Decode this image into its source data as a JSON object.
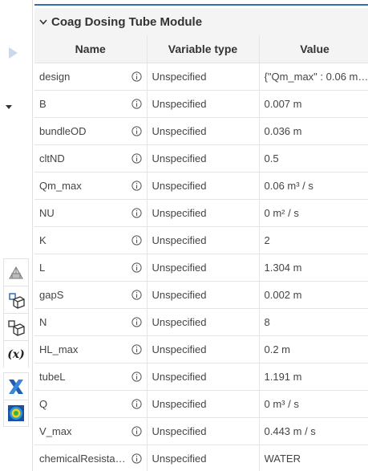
{
  "module": {
    "title": "Coag Dosing Tube Module"
  },
  "table": {
    "headers": {
      "name": "Name",
      "type": "Variable type",
      "value": "Value"
    },
    "rows": [
      {
        "name": "design",
        "type": "Unspecified",
        "value": "{\"Qm_max\" : 0.06 m…"
      },
      {
        "name": "B",
        "type": "Unspecified",
        "value": "0.007 m"
      },
      {
        "name": "bundleOD",
        "type": "Unspecified",
        "value": "0.036 m"
      },
      {
        "name": "cltND",
        "type": "Unspecified",
        "value": "0.5"
      },
      {
        "name": "Qm_max",
        "type": "Unspecified",
        "value": "0.06 m³ / s"
      },
      {
        "name": "NU",
        "type": "Unspecified",
        "value": "0 m² / s"
      },
      {
        "name": "K",
        "type": "Unspecified",
        "value": "2"
      },
      {
        "name": "L",
        "type": "Unspecified",
        "value": "1.304 m"
      },
      {
        "name": "gapS",
        "type": "Unspecified",
        "value": "0.002 m"
      },
      {
        "name": "N",
        "type": "Unspecified",
        "value": "8"
      },
      {
        "name": "HL_max",
        "type": "Unspecified",
        "value": "0.2 m"
      },
      {
        "name": "tubeL",
        "type": "Unspecified",
        "value": "1.191 m"
      },
      {
        "name": "Q",
        "type": "Unspecified",
        "value": "0 m³ / s"
      },
      {
        "name": "V_max",
        "type": "Unspecified",
        "value": "0.443 m / s"
      },
      {
        "name": "chemicalResista…",
        "type": "Unspecified",
        "value": "WATER"
      }
    ]
  },
  "toolbar": {
    "icons": [
      "part-studio-icon",
      "assembly-icon",
      "assembly-alt-icon",
      "variable-fx-icon",
      "x-app-icon",
      "simulation-icon"
    ],
    "fx_label": "(x)"
  },
  "colors": {
    "accent": "#2f6fb5",
    "header_bg": "#f4f4f4",
    "border": "#e4e4e4"
  }
}
